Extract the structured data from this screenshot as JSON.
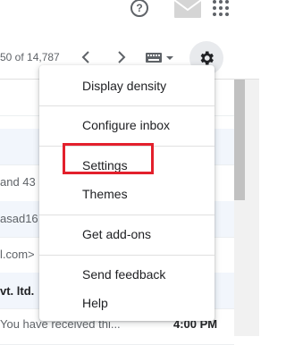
{
  "header": {
    "help_icon": "help-circle-icon",
    "account_icon": "account-envelope-icon",
    "apps_icon": "apps-grid-icon"
  },
  "toolbar": {
    "page_count": "50 of 14,787",
    "prev_icon": "chevron-left-icon",
    "next_icon": "chevron-right-icon",
    "keyboard_icon": "keyboard-icon",
    "settings_icon": "gear-icon"
  },
  "email_rows": [
    {
      "text": "",
      "bold": false
    },
    {
      "text": "",
      "bold": false
    },
    {
      "text": "and 43",
      "bold": false
    },
    {
      "text": "asad16",
      "bold": false
    },
    {
      "text": "l.com>",
      "bold": false
    },
    {
      "text": "vt. ltd.",
      "bold": true
    },
    {
      "text": "You have received thi...",
      "bold": false,
      "time": "4:00 PM"
    }
  ],
  "menu": {
    "items": [
      {
        "label": "Display density"
      },
      {
        "label": "Configure inbox"
      },
      {
        "label": "Settings"
      },
      {
        "label": "Themes"
      },
      {
        "label": "Get add-ons"
      },
      {
        "label": "Send feedback"
      },
      {
        "label": "Help"
      }
    ],
    "highlighted": "Settings",
    "highlight_color": "#e3202c"
  },
  "colors": {
    "accent_settings_bg": "#e8eaed",
    "text": "#202124",
    "muted": "#5f6368"
  }
}
